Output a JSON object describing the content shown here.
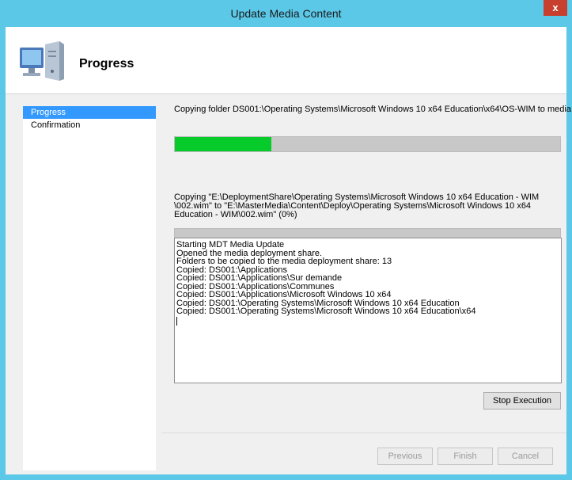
{
  "window": {
    "title": "Update Media Content",
    "close_label": "x"
  },
  "header": {
    "title": "Progress",
    "icon": "computer-icon"
  },
  "nav": {
    "items": [
      {
        "label": "Progress"
      },
      {
        "label": "Confirmation"
      }
    ]
  },
  "content": {
    "folder_status": "Copying folder DS001:\\Operating Systems\\Microsoft Windows 10 x64 Education\\x64\\OS-WIM to media",
    "overall_progress_fraction": 0.25,
    "file_status": "Copying \"E:\\DeploymentShare\\Operating Systems\\Microsoft Windows 10 x64 Education - WIM \\002.wim\" to \"E:\\MasterMedia\\Content\\Deploy\\Operating Systems\\Microsoft Windows 10 x64 Education - WIM\\002.wim\" (0%)",
    "file_progress_fraction": 0,
    "log_lines": [
      "Starting MDT Media Update",
      "Opened the media deployment share.",
      "Folders to be copied to the media deployment share: 13",
      "Copied: DS001:\\Applications",
      "Copied: DS001:\\Applications\\Sur demande",
      "Copied: DS001:\\Applications\\Communes",
      "Copied: DS001:\\Applications\\Microsoft Windows 10 x64",
      "Copied: DS001:\\Operating Systems\\Microsoft Windows 10 x64 Education",
      "Copied: DS001:\\Operating Systems\\Microsoft Windows 10 x64 Education\\x64"
    ],
    "stop_label": "Stop Execution"
  },
  "footer": {
    "previous_label": "Previous",
    "finish_label": "Finish",
    "cancel_label": "Cancel"
  },
  "colors": {
    "titlebar": "#5bc8e8",
    "progress_fill": "#06cb2a",
    "selection": "#3399ff",
    "close": "#c7402d"
  }
}
